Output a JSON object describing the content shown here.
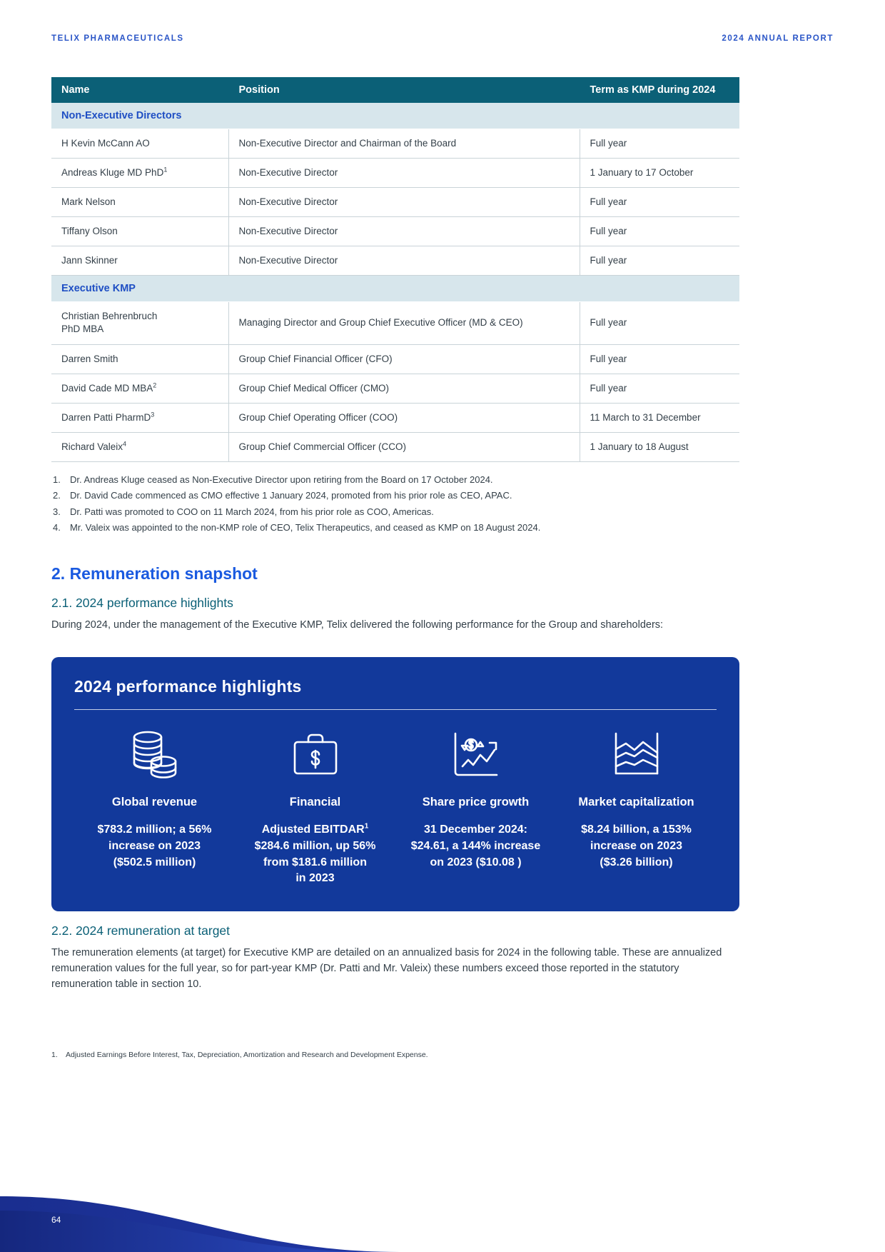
{
  "running_header": {
    "left": "TELIX PHARMACEUTICALS",
    "right": "2024 ANNUAL REPORT"
  },
  "kmp_table": {
    "columns": [
      "Name",
      "Position",
      "Term as KMP during 2024"
    ],
    "groups": [
      {
        "label": "Non-Executive Directors",
        "rows": [
          {
            "name": "H Kevin McCann AO",
            "sup": "",
            "position": "Non-Executive Director and Chairman of the Board",
            "term": "Full year"
          },
          {
            "name": "Andreas Kluge MD PhD",
            "sup": "1",
            "position": "Non-Executive Director",
            "term": "1 January to 17 October"
          },
          {
            "name": "Mark Nelson",
            "sup": "",
            "position": "Non-Executive Director",
            "term": "Full year"
          },
          {
            "name": "Tiffany Olson",
            "sup": "",
            "position": "Non-Executive Director",
            "term": "Full year"
          },
          {
            "name": "Jann Skinner",
            "sup": "",
            "position": "Non-Executive Director",
            "term": "Full year"
          }
        ]
      },
      {
        "label": "Executive KMP",
        "rows": [
          {
            "name": "Christian Behrenbruch\nPhD MBA",
            "sup": "",
            "position": "Managing Director and Group Chief Executive Officer (MD & CEO)",
            "term": "Full year"
          },
          {
            "name": "Darren Smith",
            "sup": "",
            "position": "Group Chief Financial Officer (CFO)",
            "term": "Full year"
          },
          {
            "name": "David Cade MD MBA",
            "sup": "2",
            "position": "Group Chief Medical Officer (CMO)",
            "term": "Full year"
          },
          {
            "name": "Darren Patti PharmD",
            "sup": "3",
            "position": "Group Chief Operating Officer (COO)",
            "term": "11 March to 31 December"
          },
          {
            "name": "Richard Valeix",
            "sup": "4",
            "position": "Group Chief Commercial Officer (CCO)",
            "term": "1 January to 18 August"
          }
        ]
      }
    ]
  },
  "table_footnotes": [
    {
      "num": "1.",
      "text": "Dr. Andreas Kluge ceased as Non-Executive Director upon retiring from the Board on 17 October 2024."
    },
    {
      "num": "2.",
      "text": "Dr. David Cade commenced as CMO effective 1 January 2024, promoted from his prior role as CEO, APAC."
    },
    {
      "num": "3.",
      "text": "Dr. Patti was promoted to COO on 11 March 2024, from his prior role as COO, Americas."
    },
    {
      "num": "4.",
      "text": "Mr. Valeix was appointed to the non-KMP role of CEO, Telix Therapeutics, and ceased as KMP on 18 August 2024."
    }
  ],
  "section": {
    "heading": "2. Remuneration snapshot",
    "sub_heading_1": "2.1. 2024 performance highlights",
    "paragraph_1": "During 2024, under the management of the Executive KMP, Telix delivered the following performance for the Group and shareholders:",
    "sub_heading_2": "2.2. 2024 remuneration at target",
    "paragraph_2": "The remuneration elements (at target) for Executive KMP are detailed on an annualized basis for 2024 in the following table. These are annualized remuneration values for the full year, so for part-year KMP (Dr. Patti and Mr. Valeix) these numbers exceed those reported in the statutory remuneration table in section 10."
  },
  "highlights_panel": {
    "title": "2024 performance highlights",
    "cards": [
      {
        "icon": "coin-stack-icon",
        "title": "Global revenue",
        "value": "$783.2 million; a 56%\nincrease on 2023\n($502.5 million)",
        "sup": ""
      },
      {
        "icon": "briefcase-dollar-icon",
        "title": "Financial",
        "value_prefix": "Adjusted EBITDAR",
        "sup": "1",
        "value": "\n$284.6 million, up 56%\nfrom $181.6 million\nin 2023"
      },
      {
        "icon": "chart-dollar-arrow-icon",
        "title": "Share price growth",
        "value": "31 December 2024:\n$24.61, a 144% increase\non 2023 ($10.08 )",
        "sup": ""
      },
      {
        "icon": "area-chart-icon",
        "title": "Market capitalization",
        "value": "$8.24 billion, a 153%\nincrease on 2023\n($3.26 billion)",
        "sup": ""
      }
    ]
  },
  "bottom_footnote": {
    "num": "1.",
    "text": "Adjusted Earnings Before Interest, Tax, Depreciation, Amortization and Research and Development Expense."
  },
  "page_number": "64",
  "colors": {
    "table_header_bg": "#0b6077",
    "group_row_bg": "#d7e6ec",
    "group_row_text": "#1f4fc4",
    "section_heading": "#1a5ae0",
    "sub_heading": "#0b6077",
    "panel_bg": "#12399b",
    "body_text": "#333f48",
    "running_header": "#2a55c7"
  }
}
